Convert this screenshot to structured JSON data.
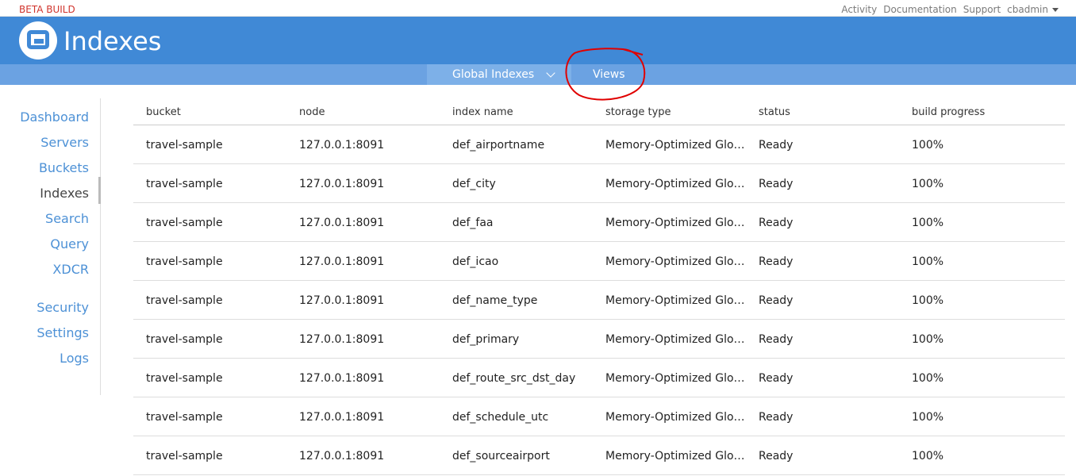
{
  "topbar": {
    "beta": "BETA BUILD",
    "links": [
      "Activity",
      "Documentation",
      "Support"
    ],
    "user": "cbadmin"
  },
  "header": {
    "title": "Indexes"
  },
  "subnav": {
    "items": [
      "Global Indexes",
      "Views"
    ]
  },
  "sidebar": {
    "items": [
      "Dashboard",
      "Servers",
      "Buckets",
      "Indexes",
      "Search",
      "Query",
      "XDCR",
      "Security",
      "Settings",
      "Logs"
    ],
    "active": "Indexes"
  },
  "table": {
    "columns": [
      "bucket",
      "node",
      "index name",
      "storage type",
      "status",
      "build progress"
    ],
    "rows": [
      [
        "travel-sample",
        "127.0.0.1:8091",
        "def_airportname",
        "Memory-Optimized Global Secondary",
        "Ready",
        "100%"
      ],
      [
        "travel-sample",
        "127.0.0.1:8091",
        "def_city",
        "Memory-Optimized Global Secondary",
        "Ready",
        "100%"
      ],
      [
        "travel-sample",
        "127.0.0.1:8091",
        "def_faa",
        "Memory-Optimized Global Secondary",
        "Ready",
        "100%"
      ],
      [
        "travel-sample",
        "127.0.0.1:8091",
        "def_icao",
        "Memory-Optimized Global Secondary",
        "Ready",
        "100%"
      ],
      [
        "travel-sample",
        "127.0.0.1:8091",
        "def_name_type",
        "Memory-Optimized Global Secondary",
        "Ready",
        "100%"
      ],
      [
        "travel-sample",
        "127.0.0.1:8091",
        "def_primary",
        "Memory-Optimized Global Secondary",
        "Ready",
        "100%"
      ],
      [
        "travel-sample",
        "127.0.0.1:8091",
        "def_route_src_dst_day",
        "Memory-Optimized Global Secondary",
        "Ready",
        "100%"
      ],
      [
        "travel-sample",
        "127.0.0.1:8091",
        "def_schedule_utc",
        "Memory-Optimized Global Secondary",
        "Ready",
        "100%"
      ],
      [
        "travel-sample",
        "127.0.0.1:8091",
        "def_sourceairport",
        "Memory-Optimized Global Secondary",
        "Ready",
        "100%"
      ]
    ]
  },
  "colors": {
    "header": "#4089d6",
    "subnav": "#6ba2e2",
    "link": "#4d91d6",
    "annotation": "#e00000"
  }
}
